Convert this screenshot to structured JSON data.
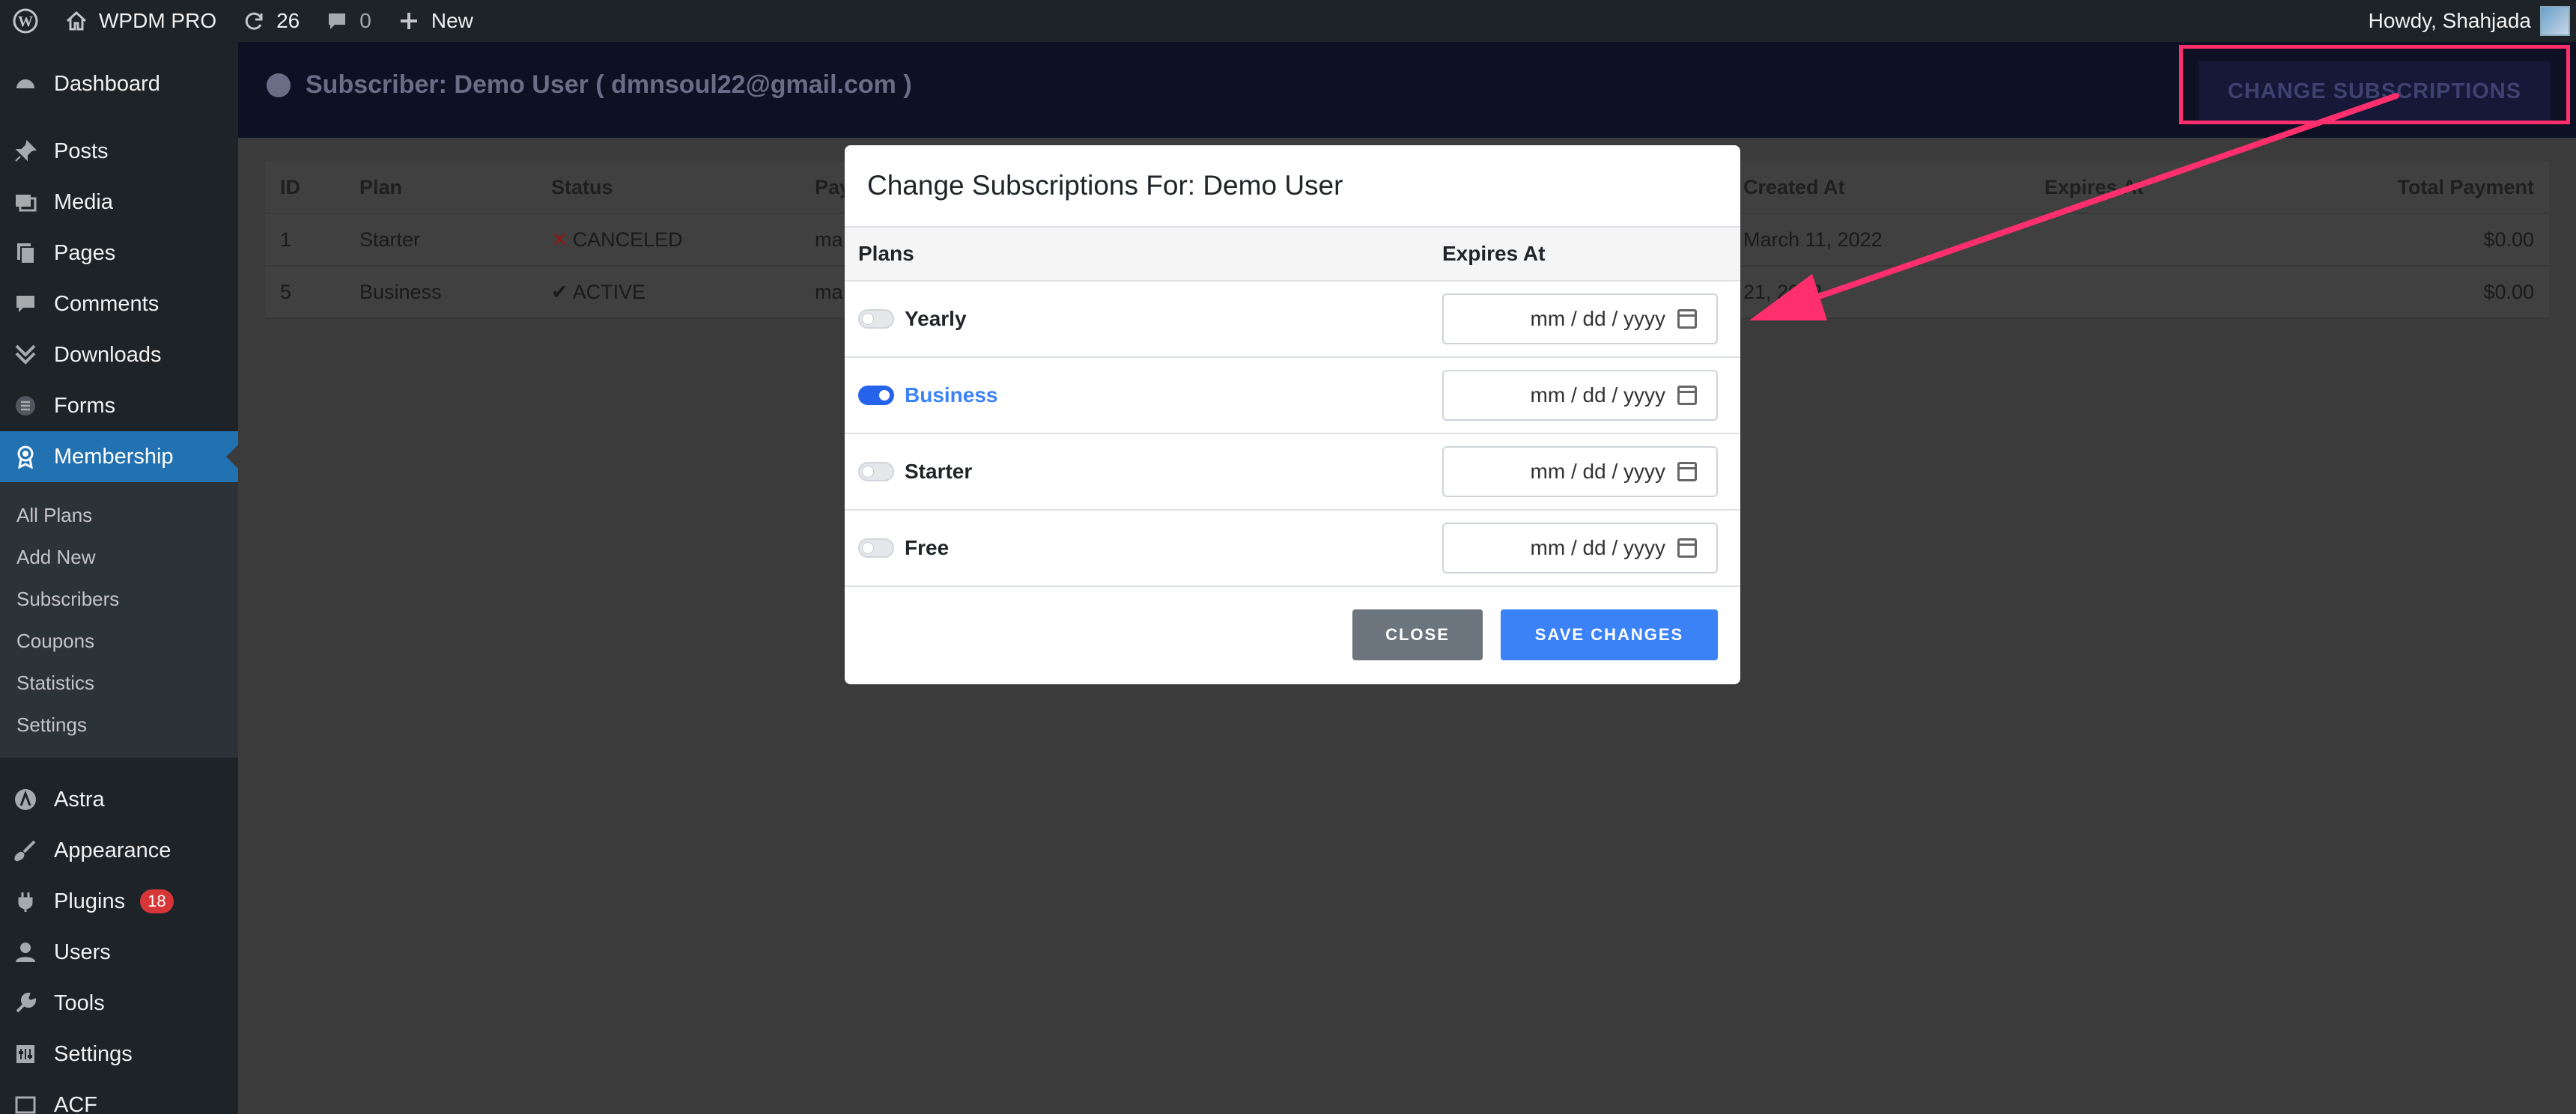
{
  "adminbar": {
    "site_name": "WPDM PRO",
    "updates_count": "26",
    "comments_count": "0",
    "new_label": "New",
    "howdy": "Howdy, Shahjada"
  },
  "sidebar": {
    "items": [
      {
        "label": "Dashboard",
        "icon": "dashboard-icon"
      },
      {
        "label": "Posts",
        "icon": "pin-icon"
      },
      {
        "label": "Media",
        "icon": "media-icon"
      },
      {
        "label": "Pages",
        "icon": "pages-icon"
      },
      {
        "label": "Comments",
        "icon": "comment-icon"
      },
      {
        "label": "Downloads",
        "icon": "download-icon"
      },
      {
        "label": "Forms",
        "icon": "forms-icon"
      },
      {
        "label": "Membership",
        "icon": "award-icon"
      }
    ],
    "submenu": [
      "All Plans",
      "Add New",
      "Subscribers",
      "Coupons",
      "Statistics",
      "Settings"
    ],
    "items2": [
      {
        "label": "Astra",
        "icon": "astra-icon"
      },
      {
        "label": "Appearance",
        "icon": "brush-icon"
      },
      {
        "label": "Plugins",
        "icon": "plugin-icon",
        "badge": "18"
      },
      {
        "label": "Users",
        "icon": "user-icon"
      },
      {
        "label": "Tools",
        "icon": "wrench-icon"
      },
      {
        "label": "Settings",
        "icon": "settings-icon"
      },
      {
        "label": "ACF",
        "icon": "acf-icon"
      }
    ]
  },
  "header": {
    "subscriber_title": "Subscriber: Demo User ( dmnsoul22@gmail.com )",
    "change_button": "CHANGE SUBSCRIPTIONS"
  },
  "table": {
    "columns": [
      "ID",
      "Plan",
      "Status",
      "Pay",
      "Created At",
      "Expires At",
      "Total Payment"
    ],
    "rows": [
      {
        "id": "1",
        "plan": "Starter",
        "status_mark": "✕",
        "status": "CANCELED",
        "pay": "ma",
        "created": "March 11, 2022",
        "expires": "",
        "total": "$0.00"
      },
      {
        "id": "5",
        "plan": "Business",
        "status_mark": "✔",
        "status": "ACTIVE",
        "pay": "ma",
        "created": "21, 2022",
        "expires": "",
        "total": "$0.00"
      }
    ]
  },
  "modal": {
    "title": "Change Subscriptions For: Demo User",
    "col_plans": "Plans",
    "col_expires": "Expires At",
    "plans": [
      {
        "name": "Yearly",
        "enabled": false,
        "date_placeholder": "mm / dd / yyyy"
      },
      {
        "name": "Business",
        "enabled": true,
        "date_placeholder": "mm / dd / yyyy"
      },
      {
        "name": "Starter",
        "enabled": false,
        "date_placeholder": "mm / dd / yyyy"
      },
      {
        "name": "Free",
        "enabled": false,
        "date_placeholder": "mm / dd / yyyy"
      }
    ],
    "close_label": "CLOSE",
    "save_label": "SAVE CHANGES"
  },
  "annotation": {
    "color": "#ff2f6e"
  }
}
